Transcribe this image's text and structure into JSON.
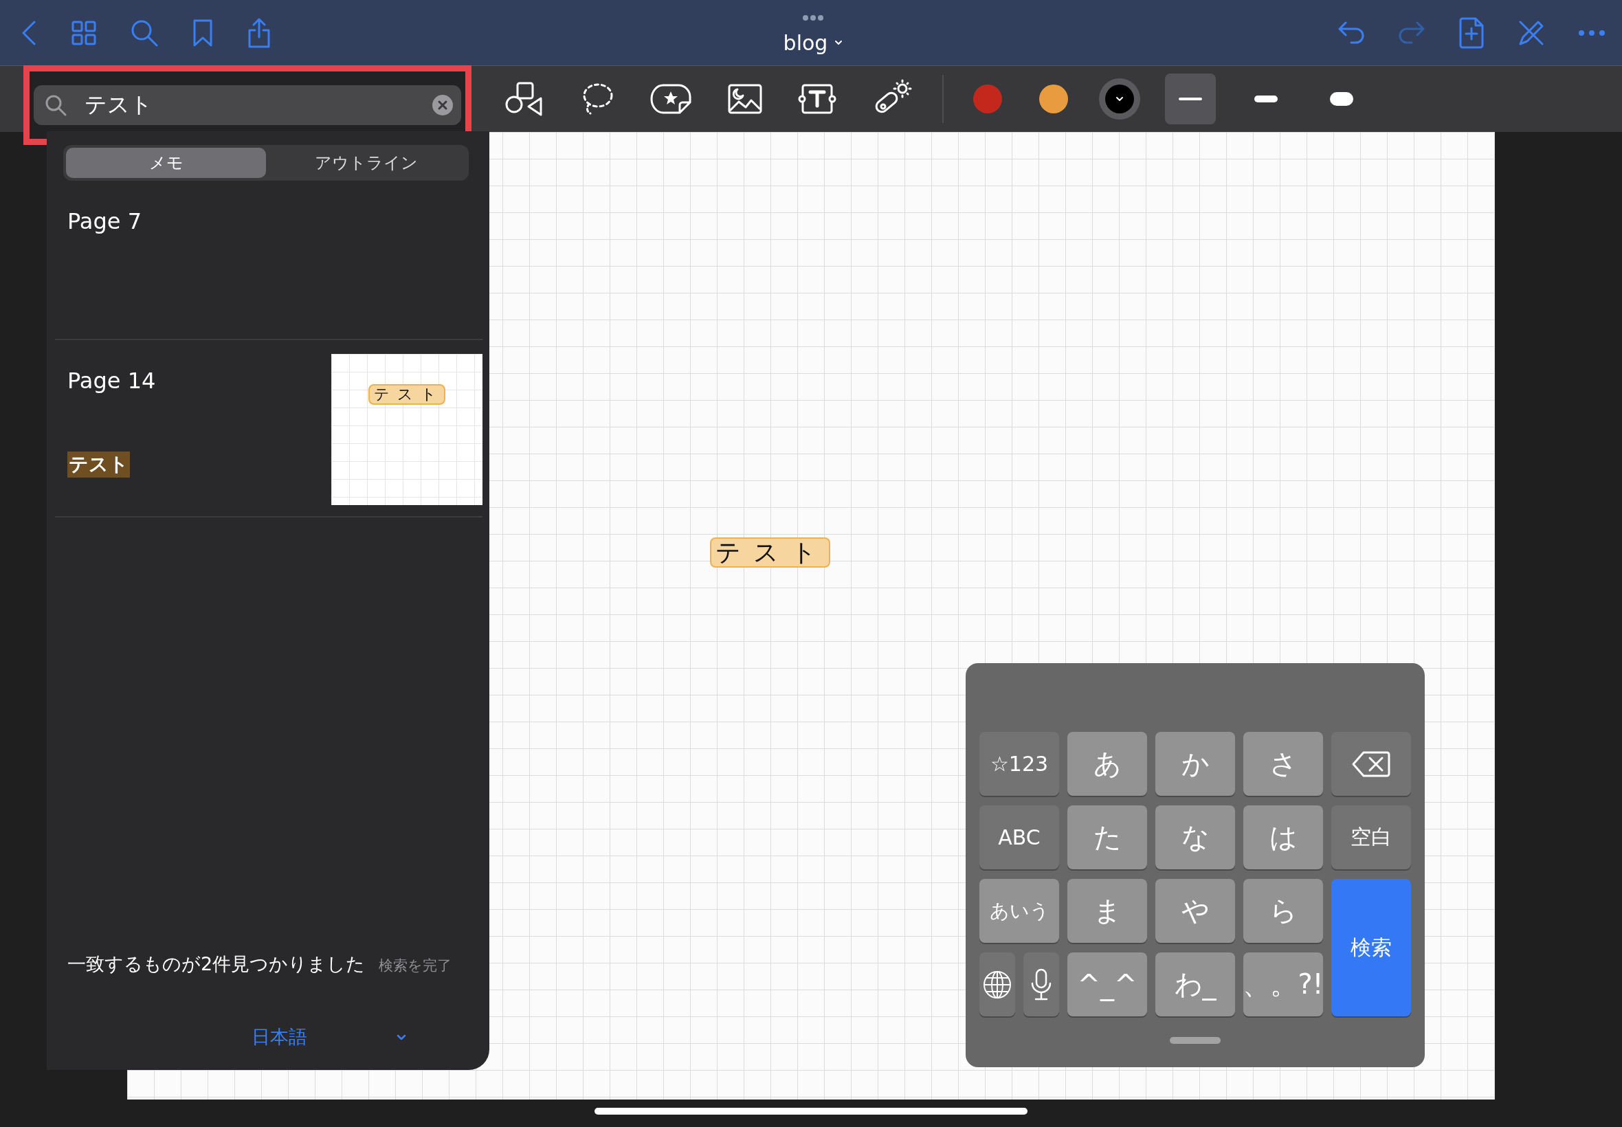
{
  "document": {
    "title": "blog"
  },
  "tools": {
    "colors": [
      {
        "color": "#c4281c",
        "selected": false
      },
      {
        "color": "#e89c3f",
        "selected": false
      },
      {
        "color": "#000000",
        "selected": true
      }
    ],
    "strokes": [
      {
        "kind": "thin",
        "selected": true
      },
      {
        "kind": "medium",
        "selected": false
      },
      {
        "kind": "thick",
        "selected": false
      }
    ]
  },
  "search": {
    "value": "テスト"
  },
  "segments": [
    {
      "label": "メモ",
      "selected": true
    },
    {
      "label": "アウトライン",
      "selected": false
    }
  ],
  "results": [
    {
      "page": "Page 7"
    },
    {
      "page": "Page 14",
      "match": "テスト",
      "thumbnail_ink": "テスト"
    }
  ],
  "summary": "一致するものが2件見つかりました",
  "done": "検索を完了",
  "language": "日本語",
  "canvas": {
    "ink": "テスト"
  },
  "keyboard": {
    "keys": [
      {
        "kind": "fn",
        "label": "☆123"
      },
      {
        "kind": "char",
        "label": "あ"
      },
      {
        "kind": "char",
        "label": "か"
      },
      {
        "kind": "char",
        "label": "さ"
      },
      {
        "kind": "backspace"
      },
      {
        "kind": "fn",
        "label": "ABC"
      },
      {
        "kind": "char",
        "label": "た"
      },
      {
        "kind": "char",
        "label": "な"
      },
      {
        "kind": "char",
        "label": "は"
      },
      {
        "kind": "fn",
        "label": "空白"
      },
      {
        "kind": "char",
        "label": "あいう"
      },
      {
        "kind": "char",
        "label": "ま"
      },
      {
        "kind": "char",
        "label": "や"
      },
      {
        "kind": "char",
        "label": "ら"
      },
      {
        "kind": "action",
        "label": "検索"
      },
      {
        "kind": "globe"
      },
      {
        "kind": "mic"
      },
      {
        "kind": "char",
        "label": "^_^"
      },
      {
        "kind": "char",
        "label": "わ_"
      },
      {
        "kind": "char",
        "label": "、。?!"
      }
    ]
  }
}
